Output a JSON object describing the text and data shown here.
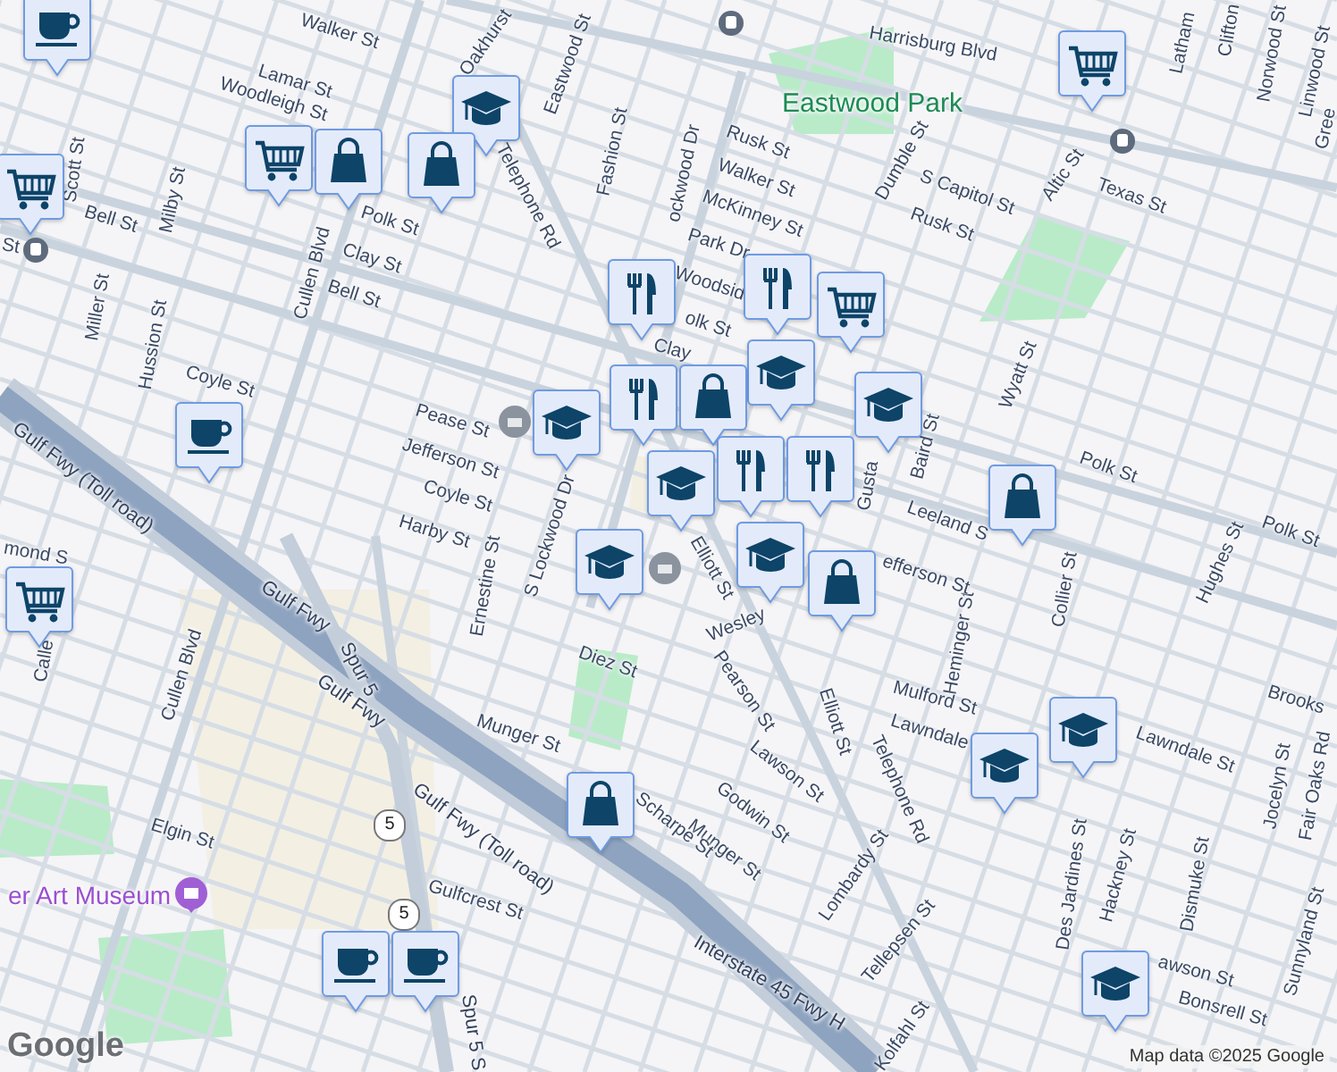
{
  "map": {
    "labels": [
      {
        "text": "Walker St",
        "kind": "street"
      },
      {
        "text": "Oakhurst",
        "kind": "street"
      },
      {
        "text": "Eastwood St",
        "kind": "street"
      },
      {
        "text": "Harrisburg Blvd",
        "kind": "street"
      },
      {
        "text": "Lamar St",
        "kind": "street"
      },
      {
        "text": "Woodleigh St",
        "kind": "street"
      },
      {
        "text": "Eastwood Park",
        "kind": "park"
      },
      {
        "text": "Fashion St",
        "kind": "street"
      },
      {
        "text": "Telephone Rd",
        "kind": "street"
      },
      {
        "text": "Rusk St",
        "kind": "street"
      },
      {
        "text": "Walker St",
        "kind": "street"
      },
      {
        "text": "ockwood Dr",
        "kind": "street"
      },
      {
        "text": "McKinney St",
        "kind": "street"
      },
      {
        "text": "Park Dr",
        "kind": "street"
      },
      {
        "text": "Woodsid",
        "kind": "street"
      },
      {
        "text": "olk St",
        "kind": "street"
      },
      {
        "text": "Clay",
        "kind": "street"
      },
      {
        "text": "Dumble St",
        "kind": "street"
      },
      {
        "text": "S Capitol St",
        "kind": "street"
      },
      {
        "text": "Rusk St",
        "kind": "street"
      },
      {
        "text": "Altic St",
        "kind": "street"
      },
      {
        "text": "Texas St",
        "kind": "street"
      },
      {
        "text": "Latham",
        "kind": "street"
      },
      {
        "text": "Clifton",
        "kind": "street"
      },
      {
        "text": "Norwood St",
        "kind": "street"
      },
      {
        "text": "Linwood St",
        "kind": "street"
      },
      {
        "text": "Gree",
        "kind": "street"
      },
      {
        "text": "Scott St",
        "kind": "street"
      },
      {
        "text": "Milby St",
        "kind": "street"
      },
      {
        "text": "Bell St",
        "kind": "street"
      },
      {
        "text": "St",
        "kind": "street"
      },
      {
        "text": "Polk St",
        "kind": "street"
      },
      {
        "text": "Cullen Blvd",
        "kind": "street"
      },
      {
        "text": "Clay St",
        "kind": "street"
      },
      {
        "text": "Bell St",
        "kind": "street"
      },
      {
        "text": "Miller St",
        "kind": "street"
      },
      {
        "text": "Hussion St",
        "kind": "street"
      },
      {
        "text": "Coyle St",
        "kind": "street"
      },
      {
        "text": "Pease St",
        "kind": "street"
      },
      {
        "text": "Jefferson St",
        "kind": "street"
      },
      {
        "text": "Coyle St",
        "kind": "street"
      },
      {
        "text": "Harby St",
        "kind": "street"
      },
      {
        "text": "Ernestine St",
        "kind": "street"
      },
      {
        "text": "S Lockwood Dr",
        "kind": "street"
      },
      {
        "text": "Elliott St",
        "kind": "street"
      },
      {
        "text": "Gusta",
        "kind": "street"
      },
      {
        "text": "Baird St",
        "kind": "street"
      },
      {
        "text": "Wyatt St",
        "kind": "street"
      },
      {
        "text": "Polk St",
        "kind": "street"
      },
      {
        "text": "Polk St",
        "kind": "street"
      },
      {
        "text": "Leeland S",
        "kind": "street"
      },
      {
        "text": "Hughes St",
        "kind": "street"
      },
      {
        "text": "Heminger St",
        "kind": "street"
      },
      {
        "text": "Collier St",
        "kind": "street"
      },
      {
        "text": "efferson St",
        "kind": "street"
      },
      {
        "text": "Wesley",
        "kind": "street"
      },
      {
        "text": "Diez St",
        "kind": "street"
      },
      {
        "text": "Pearson St",
        "kind": "street"
      },
      {
        "text": "Elliott St",
        "kind": "street"
      },
      {
        "text": "Telephone Rd",
        "kind": "street"
      },
      {
        "text": "Mulford St",
        "kind": "street"
      },
      {
        "text": "Brooks",
        "kind": "street"
      },
      {
        "text": "Lawndale",
        "kind": "street"
      },
      {
        "text": "Lawndale St",
        "kind": "street"
      },
      {
        "text": "Munger St",
        "kind": "street"
      },
      {
        "text": "Lawson St",
        "kind": "street"
      },
      {
        "text": "Godwin St",
        "kind": "street"
      },
      {
        "text": "Munger St",
        "kind": "street"
      },
      {
        "text": "Scharpe St",
        "kind": "street"
      },
      {
        "text": "Lombardy St",
        "kind": "street"
      },
      {
        "text": "Jocelyn St",
        "kind": "street"
      },
      {
        "text": "Fair Oaks Rd",
        "kind": "street"
      },
      {
        "text": "Des Jardines St",
        "kind": "street"
      },
      {
        "text": "Hackney St",
        "kind": "street"
      },
      {
        "text": "Dismuke St",
        "kind": "street"
      },
      {
        "text": "Sunnyland St",
        "kind": "street"
      },
      {
        "text": "awson St",
        "kind": "street"
      },
      {
        "text": "Bonsrell St",
        "kind": "street"
      },
      {
        "text": "Tellepsen St",
        "kind": "street"
      },
      {
        "text": "Kolfahl St",
        "kind": "street"
      },
      {
        "text": "Gulf Fwy (Toll road)",
        "kind": "highway"
      },
      {
        "text": "Gulf Fwy",
        "kind": "highway"
      },
      {
        "text": "Gulf Fwy",
        "kind": "highway"
      },
      {
        "text": "Gulf Fwy (Toll road)",
        "kind": "highway"
      },
      {
        "text": "Spur 5",
        "kind": "highway"
      },
      {
        "text": "Spur 5 S",
        "kind": "highway"
      },
      {
        "text": "Interstate 45 Fwy H",
        "kind": "highway"
      },
      {
        "text": "Cullen Blvd",
        "kind": "street"
      },
      {
        "text": "Calle",
        "kind": "street"
      },
      {
        "text": "Elgin St",
        "kind": "street"
      },
      {
        "text": "Gulfcrest St",
        "kind": "street"
      },
      {
        "text": "er Art Museum",
        "kind": "museum"
      },
      {
        "text": "mond S",
        "kind": "street"
      }
    ],
    "markers": [
      {
        "kind": "cup"
      },
      {
        "kind": "cap"
      },
      {
        "kind": "cart"
      },
      {
        "kind": "bag"
      },
      {
        "kind": "bag"
      },
      {
        "kind": "cart"
      },
      {
        "kind": "cart"
      },
      {
        "kind": "fork"
      },
      {
        "kind": "fork"
      },
      {
        "kind": "cart"
      },
      {
        "kind": "cap"
      },
      {
        "kind": "cap"
      },
      {
        "kind": "cap"
      },
      {
        "kind": "cup"
      },
      {
        "kind": "fork"
      },
      {
        "kind": "bag"
      },
      {
        "kind": "cap"
      },
      {
        "kind": "fork"
      },
      {
        "kind": "fork"
      },
      {
        "kind": "bag"
      },
      {
        "kind": "cap"
      },
      {
        "kind": "bag"
      },
      {
        "kind": "cap"
      },
      {
        "kind": "cart"
      },
      {
        "kind": "cap"
      },
      {
        "kind": "cap"
      },
      {
        "kind": "bag"
      },
      {
        "kind": "cup"
      },
      {
        "kind": "cup"
      },
      {
        "kind": "cap"
      }
    ],
    "route_shields": [
      {
        "text": "5"
      },
      {
        "text": "5"
      }
    ],
    "logo": "Google",
    "attribution": "Map data ©2025 Google"
  }
}
